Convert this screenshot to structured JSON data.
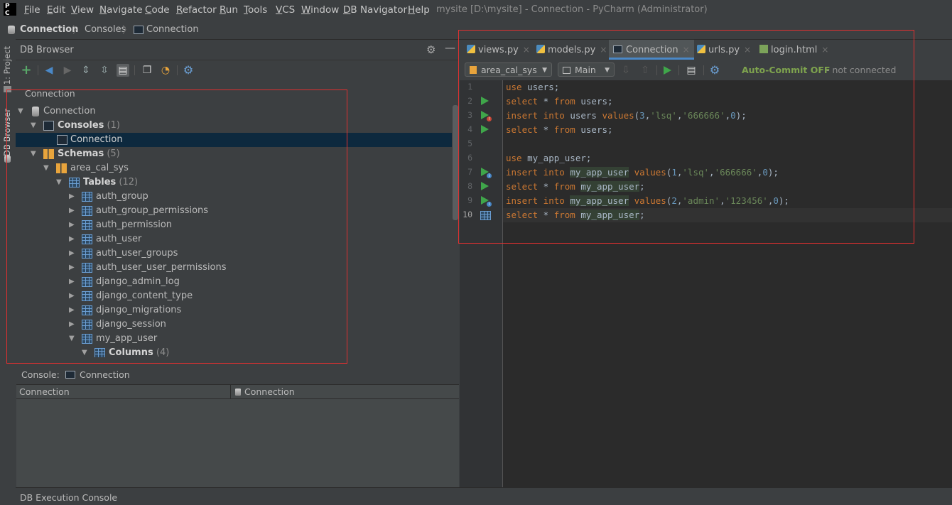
{
  "menubar": {
    "logo": [
      "P",
      "C"
    ],
    "items": [
      {
        "label": "File",
        "ul": "F",
        "rest": "ile"
      },
      {
        "label": "Edit",
        "ul": "E",
        "rest": "dit"
      },
      {
        "label": "View",
        "ul": "V",
        "rest": "iew"
      },
      {
        "label": "Navigate",
        "ul": "N",
        "rest": "avigate"
      },
      {
        "label": "Code",
        "ul": "C",
        "rest": "ode"
      },
      {
        "label": "Refactor",
        "ul": "R",
        "rest": "efactor"
      },
      {
        "label": "Run",
        "ul": "R",
        "rest": "un"
      },
      {
        "label": "Tools",
        "ul": "T",
        "rest": "ools"
      },
      {
        "label": "VCS",
        "ul": "V",
        "rest": "CS"
      },
      {
        "label": "Window",
        "ul": "W",
        "rest": "indow"
      },
      {
        "label": "DB Navigator",
        "ul": "D",
        "rest": "B Navigator"
      },
      {
        "label": "Help",
        "ul": "H",
        "rest": "elp"
      }
    ],
    "window_title": "mysite [D:\\mysite] - Connection - PyCharm (Administrator)"
  },
  "breadcrumb": [
    "Connection",
    "Consoles",
    "Connection"
  ],
  "stripe": {
    "project_tab": "1: Project",
    "db_tab": "DB Browser"
  },
  "db_browser": {
    "title": "DB Browser",
    "connection_label": "Connection",
    "tree": [
      {
        "label": "Connection",
        "count": "",
        "bold": false
      },
      {
        "label": "Consoles",
        "count": "(1)",
        "bold": true
      },
      {
        "label": "Connection",
        "count": "",
        "bold": false
      },
      {
        "label": "Schemas",
        "count": "(5)",
        "bold": true
      },
      {
        "label": "area_cal_sys",
        "count": "",
        "bold": false
      },
      {
        "label": "Tables",
        "count": "(12)",
        "bold": true
      },
      {
        "label": "auth_group",
        "count": "",
        "bold": false
      },
      {
        "label": "auth_group_permissions",
        "count": "",
        "bold": false
      },
      {
        "label": "auth_permission",
        "count": "",
        "bold": false
      },
      {
        "label": "auth_user",
        "count": "",
        "bold": false
      },
      {
        "label": "auth_user_groups",
        "count": "",
        "bold": false
      },
      {
        "label": "auth_user_user_permissions",
        "count": "",
        "bold": false
      },
      {
        "label": "django_admin_log",
        "count": "",
        "bold": false
      },
      {
        "label": "django_content_type",
        "count": "",
        "bold": false
      },
      {
        "label": "django_migrations",
        "count": "",
        "bold": false
      },
      {
        "label": "django_session",
        "count": "",
        "bold": false
      },
      {
        "label": "my_app_user",
        "count": "",
        "bold": false
      },
      {
        "label": "Columns",
        "count": "(4)",
        "bold": true
      }
    ],
    "console_label": "Console:",
    "console_value": "Connection",
    "table_headers": [
      "Connection",
      "Connection"
    ]
  },
  "editor": {
    "tabs": [
      {
        "label": "views.py"
      },
      {
        "label": "models.py"
      },
      {
        "label": "Connection"
      },
      {
        "label": "urls.py"
      },
      {
        "label": "login.html"
      }
    ],
    "tab_close": "×",
    "schema_combo": "area_cal_sys",
    "session_combo": "Main",
    "auto_commit": "Auto-Commit OFF",
    "connection_status": "- not connected",
    "line_numbers": [
      "1",
      "2",
      "3",
      "4",
      "5",
      "6",
      "7",
      "8",
      "9",
      "10"
    ]
  },
  "code": {
    "l1": [
      "use",
      " users;"
    ],
    "l2": [
      "select",
      " * ",
      "from",
      " users;"
    ],
    "l3": [
      "insert into",
      " users ",
      "values",
      "(",
      "3",
      ",",
      "'lsq'",
      ",",
      "'666666'",
      ",",
      "0",
      ");"
    ],
    "l4": [
      "select",
      " * ",
      "from",
      " users;"
    ],
    "l6": [
      "use",
      " my_app_user;"
    ],
    "l7": [
      "insert into",
      " ",
      "my_app_user",
      " ",
      "values",
      "(",
      "1",
      ",",
      "'lsq'",
      ",",
      "'666666'",
      ",",
      "0",
      ");"
    ],
    "l8": [
      "select",
      " * ",
      "from",
      " ",
      "my_app_user",
      ";"
    ],
    "l9": [
      "insert into",
      " ",
      "my_app_user",
      " ",
      "values",
      "(",
      "2",
      ",",
      "'admin'",
      ",",
      "'123456'",
      ",",
      "0",
      ");"
    ],
    "l10": [
      "select",
      " * ",
      "from",
      " ",
      "my_app_user",
      ";"
    ]
  },
  "statusbar": {
    "label": "DB Execution Console"
  },
  "colors": {
    "accent": "#4a88c7",
    "run_green": "#3fa64a",
    "annotation_red": "#e03030",
    "autocommit_green": "#7ea34e"
  }
}
